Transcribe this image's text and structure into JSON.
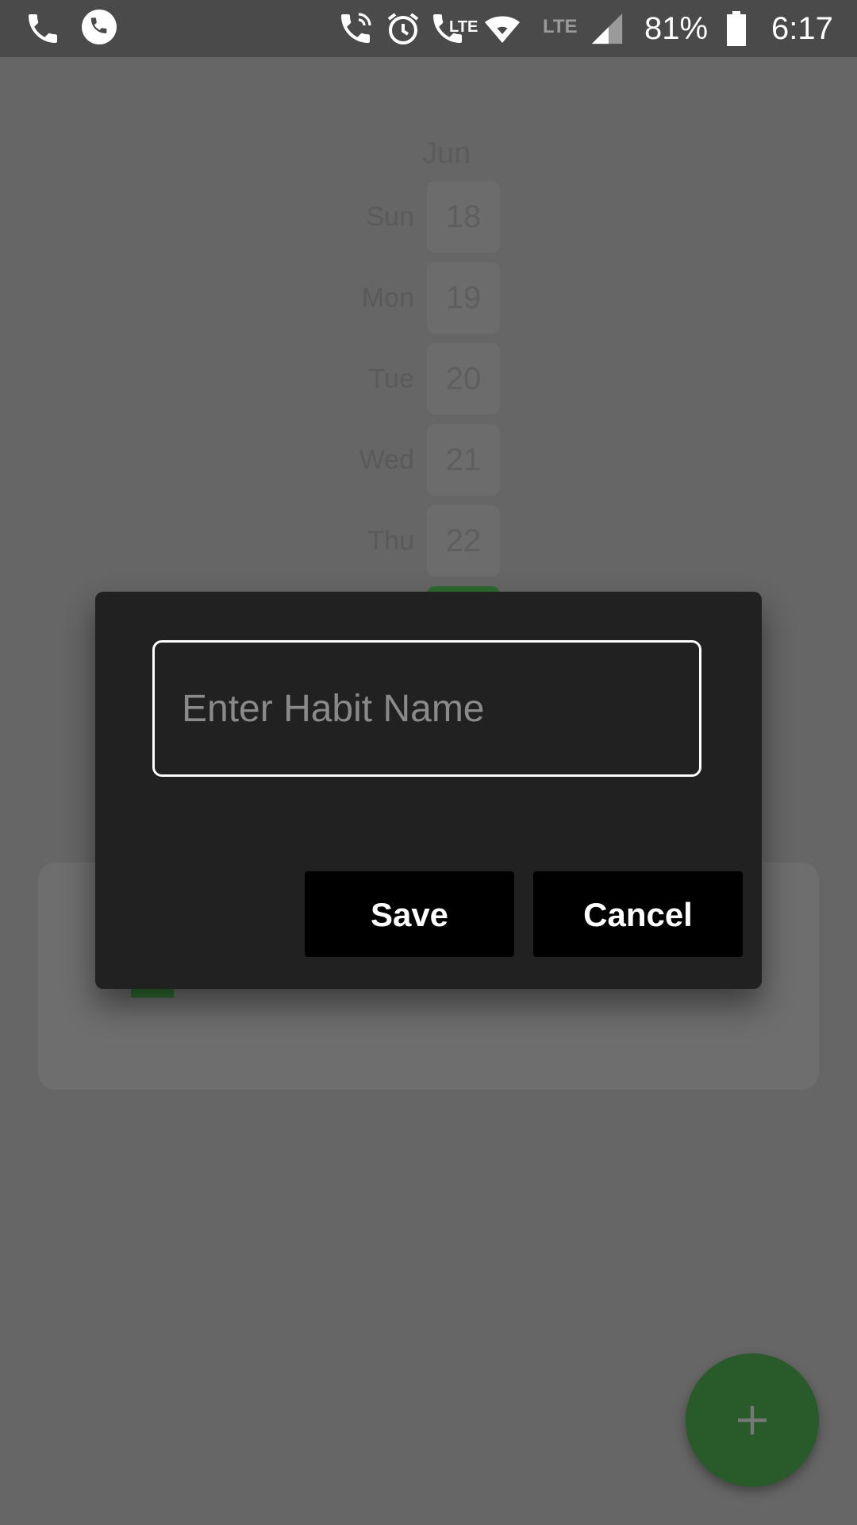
{
  "status_bar": {
    "battery_percent": "81%",
    "time": "6:17",
    "network_label": "LTE",
    "call_network_label": "LTE",
    "icons": [
      "phone-icon",
      "whatsapp-icon",
      "wifi-call-icon",
      "alarm-icon",
      "lte-call-icon",
      "wifi-icon",
      "signal-icon",
      "battery-icon"
    ]
  },
  "calendar": {
    "month": "Jun",
    "days": [
      {
        "name": "Sun",
        "number": "18"
      },
      {
        "name": "Mon",
        "number": "19"
      },
      {
        "name": "Tue",
        "number": "20"
      },
      {
        "name": "Wed",
        "number": "21"
      },
      {
        "name": "Thu",
        "number": "22"
      }
    ],
    "selected_color": "#2e6b30"
  },
  "dialog": {
    "input_placeholder": "Enter Habit Name",
    "input_value": "",
    "save_label": "Save",
    "cancel_label": "Cancel"
  },
  "fab": {
    "icon": "plus-icon",
    "color": "#285a2a"
  },
  "colors": {
    "accent_green": "#2e6b30",
    "dialog_background": "#212121",
    "scrim": "#666666"
  }
}
